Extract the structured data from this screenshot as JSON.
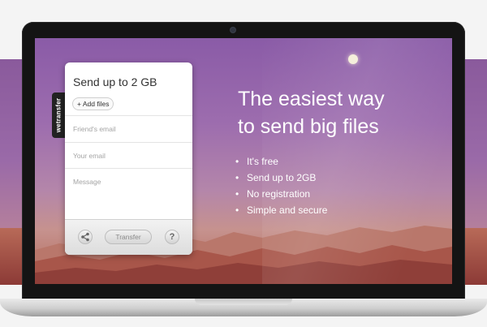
{
  "brand": {
    "tab_label": "wetransfer"
  },
  "panel": {
    "title": "Send up to 2 GB",
    "add_files_label": "+ Add files",
    "friends_email_placeholder": "Friend's email",
    "your_email_placeholder": "Your email",
    "message_placeholder": "Message",
    "transfer_label": "Transfer",
    "help_label": "?"
  },
  "hero": {
    "headline_line1": "The easiest way",
    "headline_line2": "to send big files",
    "features": [
      "It's free",
      "Send up to 2GB",
      "No registration",
      "Simple and secure"
    ]
  },
  "icons": {
    "share": "share-icon",
    "help": "question-icon"
  },
  "colors": {
    "sky_top": "#8a5ba7",
    "sky_bottom": "#c6928e",
    "desert": "#b26a5a",
    "tab_bg": "#222222"
  }
}
